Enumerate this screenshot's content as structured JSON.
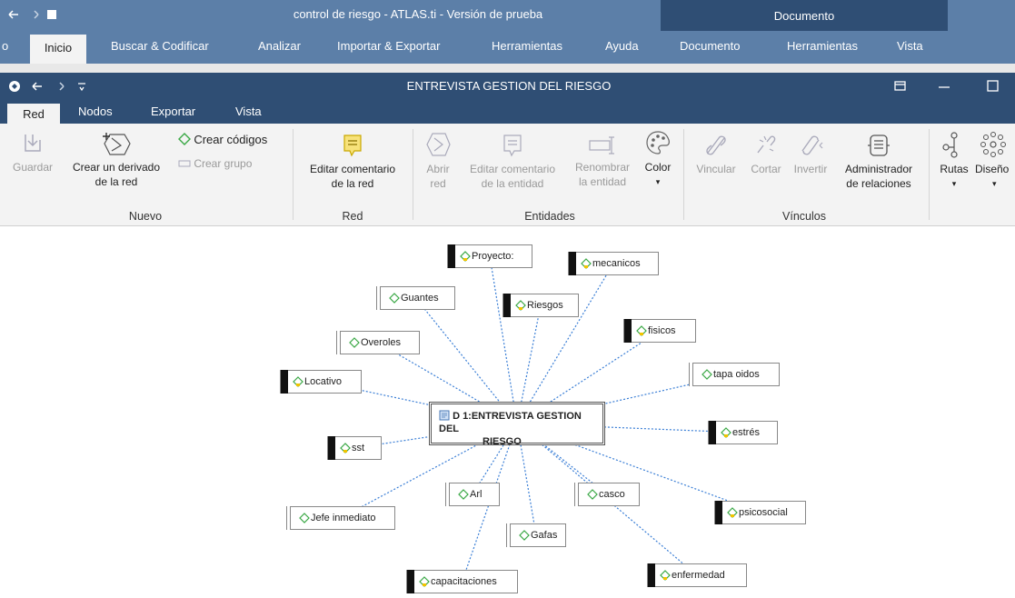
{
  "outer_window": {
    "title": "control de riesgo - ATLAS.ti - Versión de prueba",
    "context_label": "Documento",
    "tabs": [
      "o",
      "Inicio",
      "Buscar & Codificar",
      "Analizar",
      "Importar & Exportar",
      "Herramientas",
      "Ayuda",
      "Documento",
      "Herramientas",
      "Vista"
    ],
    "active_tab": "Inicio"
  },
  "inner_window": {
    "title": "ENTREVISTA GESTION DEL RIESGO",
    "tabs": [
      "Red",
      "Nodos",
      "Exportar",
      "Vista"
    ],
    "active_tab": "Red"
  },
  "ribbon": {
    "nuevo": {
      "label": "Nuevo",
      "guardar": "Guardar",
      "crear_derivado_1": "Crear un derivado",
      "crear_derivado_2": "de la red",
      "crear_codigos": "Crear códigos",
      "crear_grupo": "Crear grupo"
    },
    "red": {
      "label": "Red",
      "editar_comentario_1": "Editar comentario",
      "editar_comentario_2": "de la red"
    },
    "entidades": {
      "label": "Entidades",
      "abrir_1": "Abrir",
      "abrir_2": "red",
      "editar_ent_1": "Editar comentario",
      "editar_ent_2": "de la entidad",
      "renombrar_1": "Renombrar",
      "renombrar_2": "la entidad",
      "color": "Color",
      "color_arrow": "▾"
    },
    "vinculos": {
      "label": "Vínculos",
      "vincular": "Vincular",
      "cortar": "Cortar",
      "invertir": "Invertir",
      "admin_1": "Administrador",
      "admin_2": "de relaciones"
    },
    "rutas": "Rutas",
    "disenos": "Diseño",
    "dropdown_arrow": "▾"
  },
  "network": {
    "center": {
      "line1": "D 1:ENTREVISTA GESTION DEL",
      "line2": "RIESGO",
      "icon": "document-icon"
    },
    "nodes": [
      {
        "id": "proyecto",
        "label": "Proyecto:"
      },
      {
        "id": "mecanicos",
        "label": "mecanicos"
      },
      {
        "id": "guantes",
        "label": "Guantes"
      },
      {
        "id": "riesgos",
        "label": "Riesgos"
      },
      {
        "id": "fisicos",
        "label": "fisicos"
      },
      {
        "id": "overoles",
        "label": "Overoles"
      },
      {
        "id": "tapa-oidos",
        "label": "tapa oidos"
      },
      {
        "id": "locativo",
        "label": "Locativo"
      },
      {
        "id": "estres",
        "label": "estrés"
      },
      {
        "id": "sst",
        "label": "sst"
      },
      {
        "id": "arl",
        "label": "Arl"
      },
      {
        "id": "casco",
        "label": "casco"
      },
      {
        "id": "jefe-inmediato",
        "label": "Jefe inmediato"
      },
      {
        "id": "psicosocial",
        "label": "psicosocial"
      },
      {
        "id": "gafas",
        "label": "Gafas"
      },
      {
        "id": "enfermedad",
        "label": "enfermedad"
      },
      {
        "id": "capacitaciones",
        "label": "capacitaciones"
      }
    ],
    "link_color": "#3b7fd6",
    "code_icon_color": "#3aa845"
  }
}
